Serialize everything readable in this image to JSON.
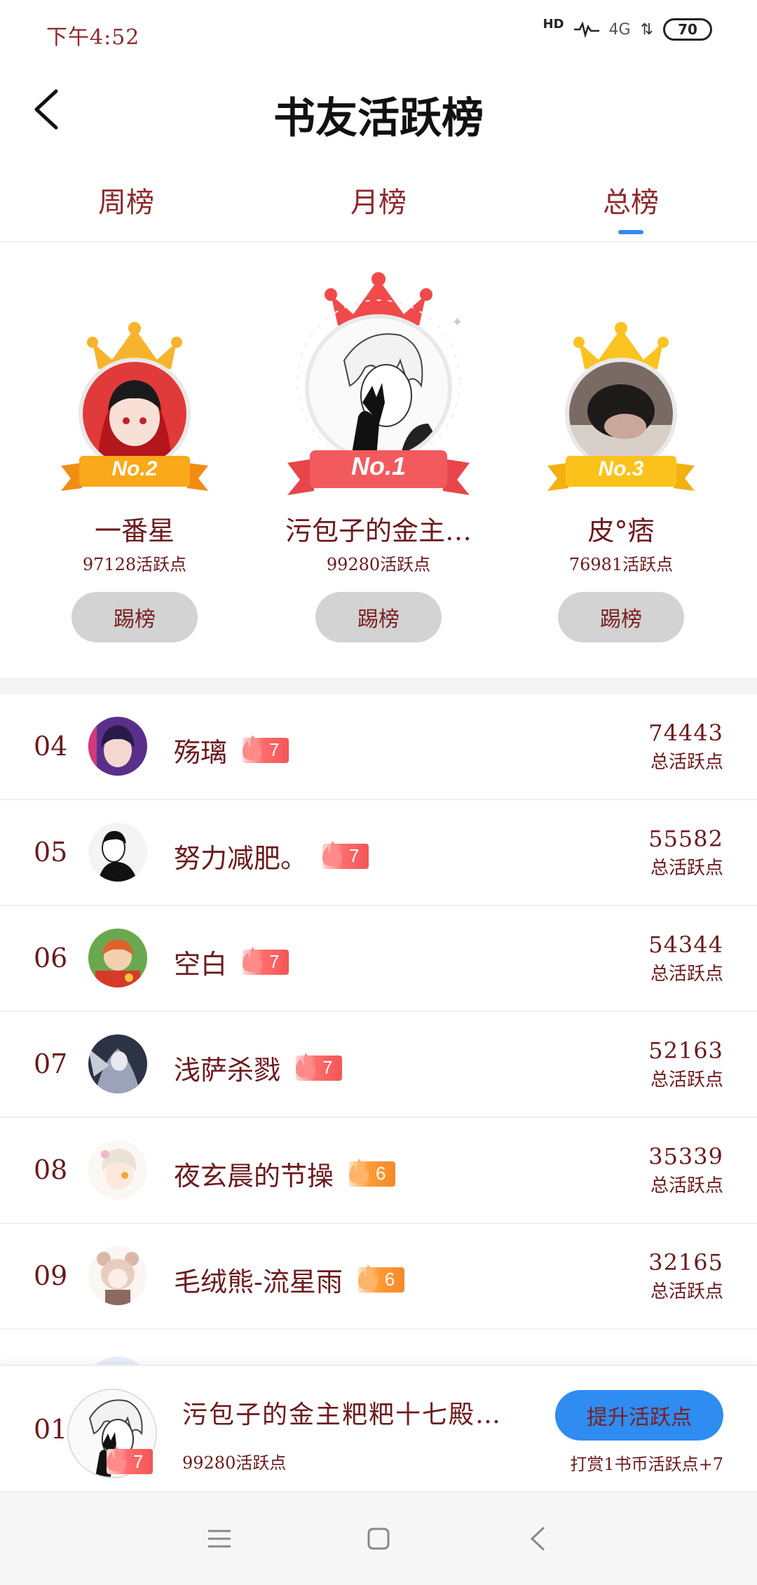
{
  "status_bar": {
    "time": "下午4:52",
    "hd": "HD",
    "network": "4G",
    "battery": "70"
  },
  "header": {
    "title": "书友活跃榜"
  },
  "tabs": [
    {
      "label": "周榜",
      "active": false
    },
    {
      "label": "月榜",
      "active": false
    },
    {
      "label": "总榜",
      "active": true
    }
  ],
  "podium": {
    "second": {
      "rank_label": "No.2",
      "name": "一番星",
      "points": "97128活跃点",
      "button": "踢榜"
    },
    "first": {
      "rank_label": "No.1",
      "name": "污包子的金主…",
      "points": "99280活跃点",
      "button": "踢榜"
    },
    "third": {
      "rank_label": "No.3",
      "name": "皮°痞",
      "points": "76981活跃点",
      "button": "踢榜"
    }
  },
  "list": [
    {
      "rank": "04",
      "name": "殇璃",
      "level": "7",
      "score": "74443",
      "score_label": "总活跃点"
    },
    {
      "rank": "05",
      "name": "努力减肥。",
      "level": "7",
      "score": "55582",
      "score_label": "总活跃点"
    },
    {
      "rank": "06",
      "name": "空白",
      "level": "7",
      "score": "54344",
      "score_label": "总活跃点"
    },
    {
      "rank": "07",
      "name": "浅萨杀戮",
      "level": "7",
      "score": "52163",
      "score_label": "总活跃点"
    },
    {
      "rank": "08",
      "name": "夜玄晨的节操",
      "level": "6",
      "score": "35339",
      "score_label": "总活跃点"
    },
    {
      "rank": "09",
      "name": "毛绒熊-流星雨",
      "level": "6",
      "score": "32165",
      "score_label": "总活跃点"
    }
  ],
  "my_rank": {
    "rank": "01",
    "name": "污包子的金主粑粑十七殿…",
    "level": "7",
    "points": "99280活跃点",
    "button": "提升活跃点",
    "reward_note": "打赏1书币活跃点+7"
  },
  "colors": {
    "accent": "#2f8cf0",
    "text": "#6b1a1d",
    "button_gray": "#d3d3d3",
    "badge_red": "#f25656",
    "badge_orange": "#f5892a"
  }
}
